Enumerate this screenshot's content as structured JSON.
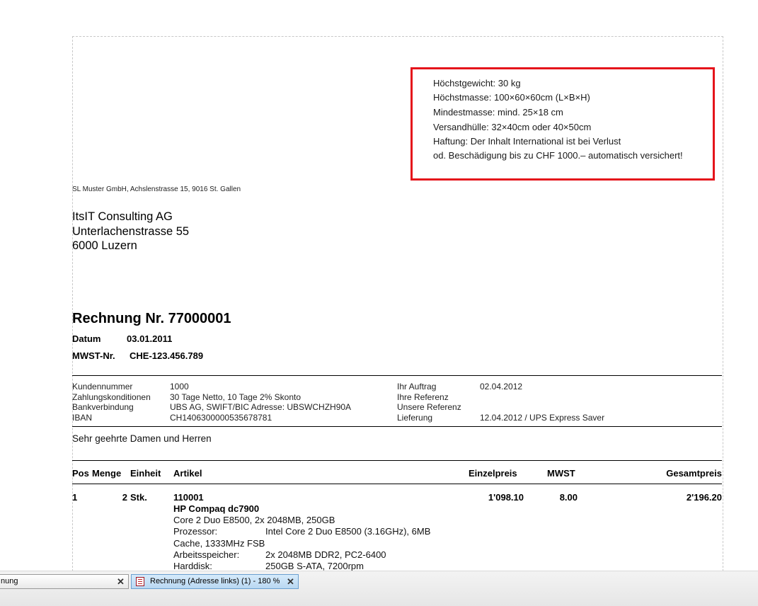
{
  "notice": {
    "lines": [
      "Höchstgewicht: 30 kg",
      "Höchstmasse: 100×60×60cm (L×B×H)",
      "Mindestmasse: mind. 25×18 cm",
      "Versandhülle: 32×40cm oder 40×50cm",
      "Haftung: Der Inhalt International ist bei Verlust",
      "od. Beschädigung bis zu CHF 1000.– automatisch versichert!"
    ],
    "border_color": "#e5141b"
  },
  "sender_line": "SL Muster GmbH, Achslenstrasse 15, 9016 St. Gallen",
  "recipient": [
    "ItsIT Consulting AG",
    "Unterlachenstrasse 55",
    "6000 Luzern"
  ],
  "invoice": {
    "title": "Rechnung Nr. 77000001",
    "date_label": "Datum",
    "date_value": "03.01.2011",
    "vat_label": "MWST-Nr.",
    "vat_value": "CHE-123.456.789"
  },
  "info_left": {
    "labels": [
      "Kundennummer",
      "Zahlungskonditionen",
      "Bankverbindung",
      "IBAN"
    ],
    "values": [
      "1000",
      "30 Tage Netto, 10 Tage 2% Skonto",
      "UBS AG, SWIFT/BIC Adresse: UBSWCHZH90A",
      "CH1406300000535678781"
    ]
  },
  "info_right": {
    "labels": [
      "Ihr Auftrag",
      "Ihre Referenz",
      "Unsere Referenz",
      "Lieferung"
    ],
    "values": [
      "02.04.2012",
      "",
      "",
      "12.04.2012 / UPS Express Saver"
    ]
  },
  "greeting": "Sehr geehrte Damen und Herren",
  "table": {
    "headers": {
      "pos": "Pos",
      "menge": "Menge",
      "einheit": "Einheit",
      "artikel": "Artikel",
      "einzelpreis": "Einzelpreis",
      "mwst": "MWST",
      "gesamtpreis": "Gesamtpreis"
    },
    "row": {
      "pos": "1",
      "menge": "2",
      "einheit": "Stk.",
      "artikel_nr": "110001",
      "artikel_name": "HP Compaq dc7900",
      "einzelpreis": "1'098.10",
      "mwst": "8.00",
      "gesamtpreis": "2'196.20",
      "desc_line1": "Core 2 Duo E8500, 2x 2048MB, 250GB",
      "prozessor_label": "Prozessor:",
      "prozessor_value": "Intel Core 2 Duo E8500 (3.16GHz), 6MB",
      "prozessor_cont": "Cache, 1333MHz FSB",
      "arbeitsspeicher_label": "Arbeitsspeicher:",
      "arbeitsspeicher_value": "2x 2048MB DDR2, PC2-6400",
      "harddisk_label": "Harddisk:",
      "harddisk_value": "250GB S-ATA, 7200rpm"
    }
  },
  "taskbar": {
    "tab1_label": "nung",
    "tab2_label": "Rechnung (Adresse links) (1) - 180 %",
    "close_glyph": "✕"
  }
}
